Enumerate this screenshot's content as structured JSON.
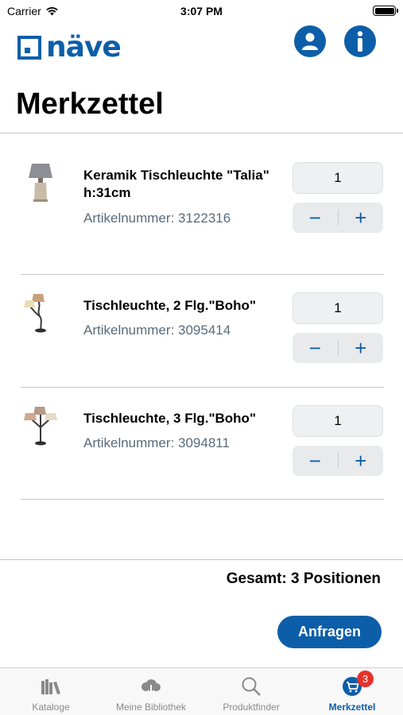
{
  "status_bar": {
    "carrier": "Carrier",
    "time": "3:07 PM"
  },
  "header": {
    "logo_text": "näve",
    "title": "Merkzettel"
  },
  "items": [
    {
      "name": "Keramik Tischleuchte \"Talia\" h:31cm",
      "article": "Artikelnummer: 3122316",
      "quantity": "1"
    },
    {
      "name": "Tischleuchte, 2 Flg.\"Boho\"",
      "article": "Artikelnummer: 3095414",
      "quantity": "1"
    },
    {
      "name": "Tischleuchte, 3 Flg.\"Boho\"",
      "article": "Artikelnummer: 3094811",
      "quantity": "1"
    }
  ],
  "stepper": {
    "minus": "−",
    "plus": "+"
  },
  "summary": {
    "total": "Gesamt: 3 Positionen",
    "request_label": "Anfragen"
  },
  "tabbar": {
    "tabs": [
      {
        "label": "Kataloge",
        "icon": "books-icon"
      },
      {
        "label": "Meine Bibliothek",
        "icon": "cloud-download-icon"
      },
      {
        "label": "Produktfinder",
        "icon": "search-icon"
      },
      {
        "label": "Merkzettel",
        "icon": "cart-icon",
        "badge": "3",
        "active": true
      }
    ]
  },
  "colors": {
    "brand": "#0d5ea8",
    "badge": "#e5322b"
  }
}
